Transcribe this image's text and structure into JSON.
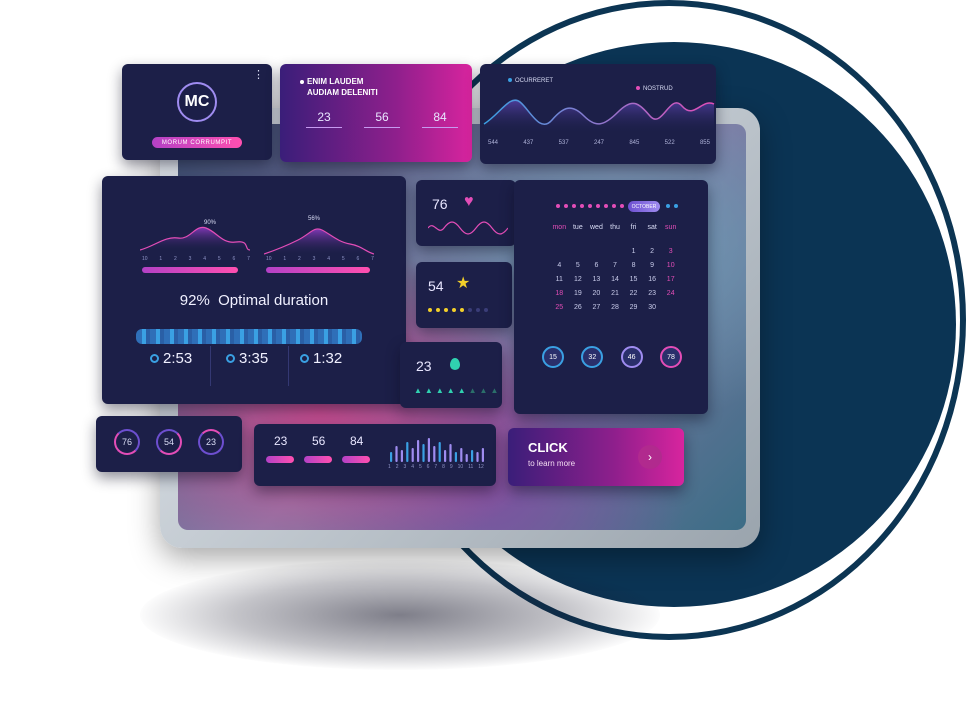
{
  "profile": {
    "initials": "MC",
    "badge": "MORUM CORRUMPIT",
    "menu_icon": "kebab-menu-icon"
  },
  "header_card": {
    "title_line1": "ENIM LAUDEM",
    "title_line2": "AUDIAM DELENITI",
    "values": [
      "23",
      "56",
      "84"
    ]
  },
  "wave_chart": {
    "legend": [
      "OCURRERET",
      "NOSTRUD"
    ],
    "values": [
      "544",
      "437",
      "537",
      "247",
      "845",
      "522",
      "855"
    ]
  },
  "main_panel": {
    "peak_left": "90%",
    "peak_right": "56%",
    "axis_ticks": [
      "10",
      "1",
      "2",
      "3",
      "4",
      "5",
      "6",
      "7"
    ],
    "headline": "92%  Optimal duration",
    "timers": [
      "2:53",
      "3:35",
      "1:32"
    ]
  },
  "heart_card": {
    "value": "76",
    "icon": "heart-icon"
  },
  "star_card": {
    "value": "54",
    "icon": "star-icon"
  },
  "tree_card": {
    "value": "23",
    "icon": "leaf-icon"
  },
  "calendar": {
    "month": "OCTOBER",
    "weekdays": [
      "mon",
      "tue",
      "wed",
      "thu",
      "fri",
      "sat",
      "sun"
    ],
    "rows": [
      [
        "",
        "",
        "",
        "",
        "1",
        "2",
        "3"
      ],
      [
        "4",
        "5",
        "6",
        "7",
        "8",
        "9",
        "10"
      ],
      [
        "11",
        "12",
        "13",
        "14",
        "15",
        "16",
        "17"
      ],
      [
        "18",
        "19",
        "20",
        "21",
        "22",
        "23",
        "24"
      ],
      [
        "25",
        "26",
        "27",
        "28",
        "29",
        "30",
        ""
      ]
    ],
    "badges": [
      "15",
      "32",
      "46",
      "78"
    ]
  },
  "rings_card": {
    "values": [
      "76",
      "54",
      "23"
    ]
  },
  "bars_card": {
    "values": [
      "23",
      "56",
      "84"
    ],
    "ticks": [
      "1",
      "2",
      "3",
      "4",
      "5",
      "6",
      "7",
      "8",
      "9",
      "10",
      "11",
      "12"
    ]
  },
  "cta": {
    "title": "CLICK",
    "subtitle": "to learn more",
    "icon": "chevron-right-icon"
  },
  "colors": {
    "navy": "#0b3454",
    "card": "#1c1f48",
    "pink": "#e34db7",
    "purple": "#6d4fd0",
    "cyan": "#3aa0e3"
  }
}
